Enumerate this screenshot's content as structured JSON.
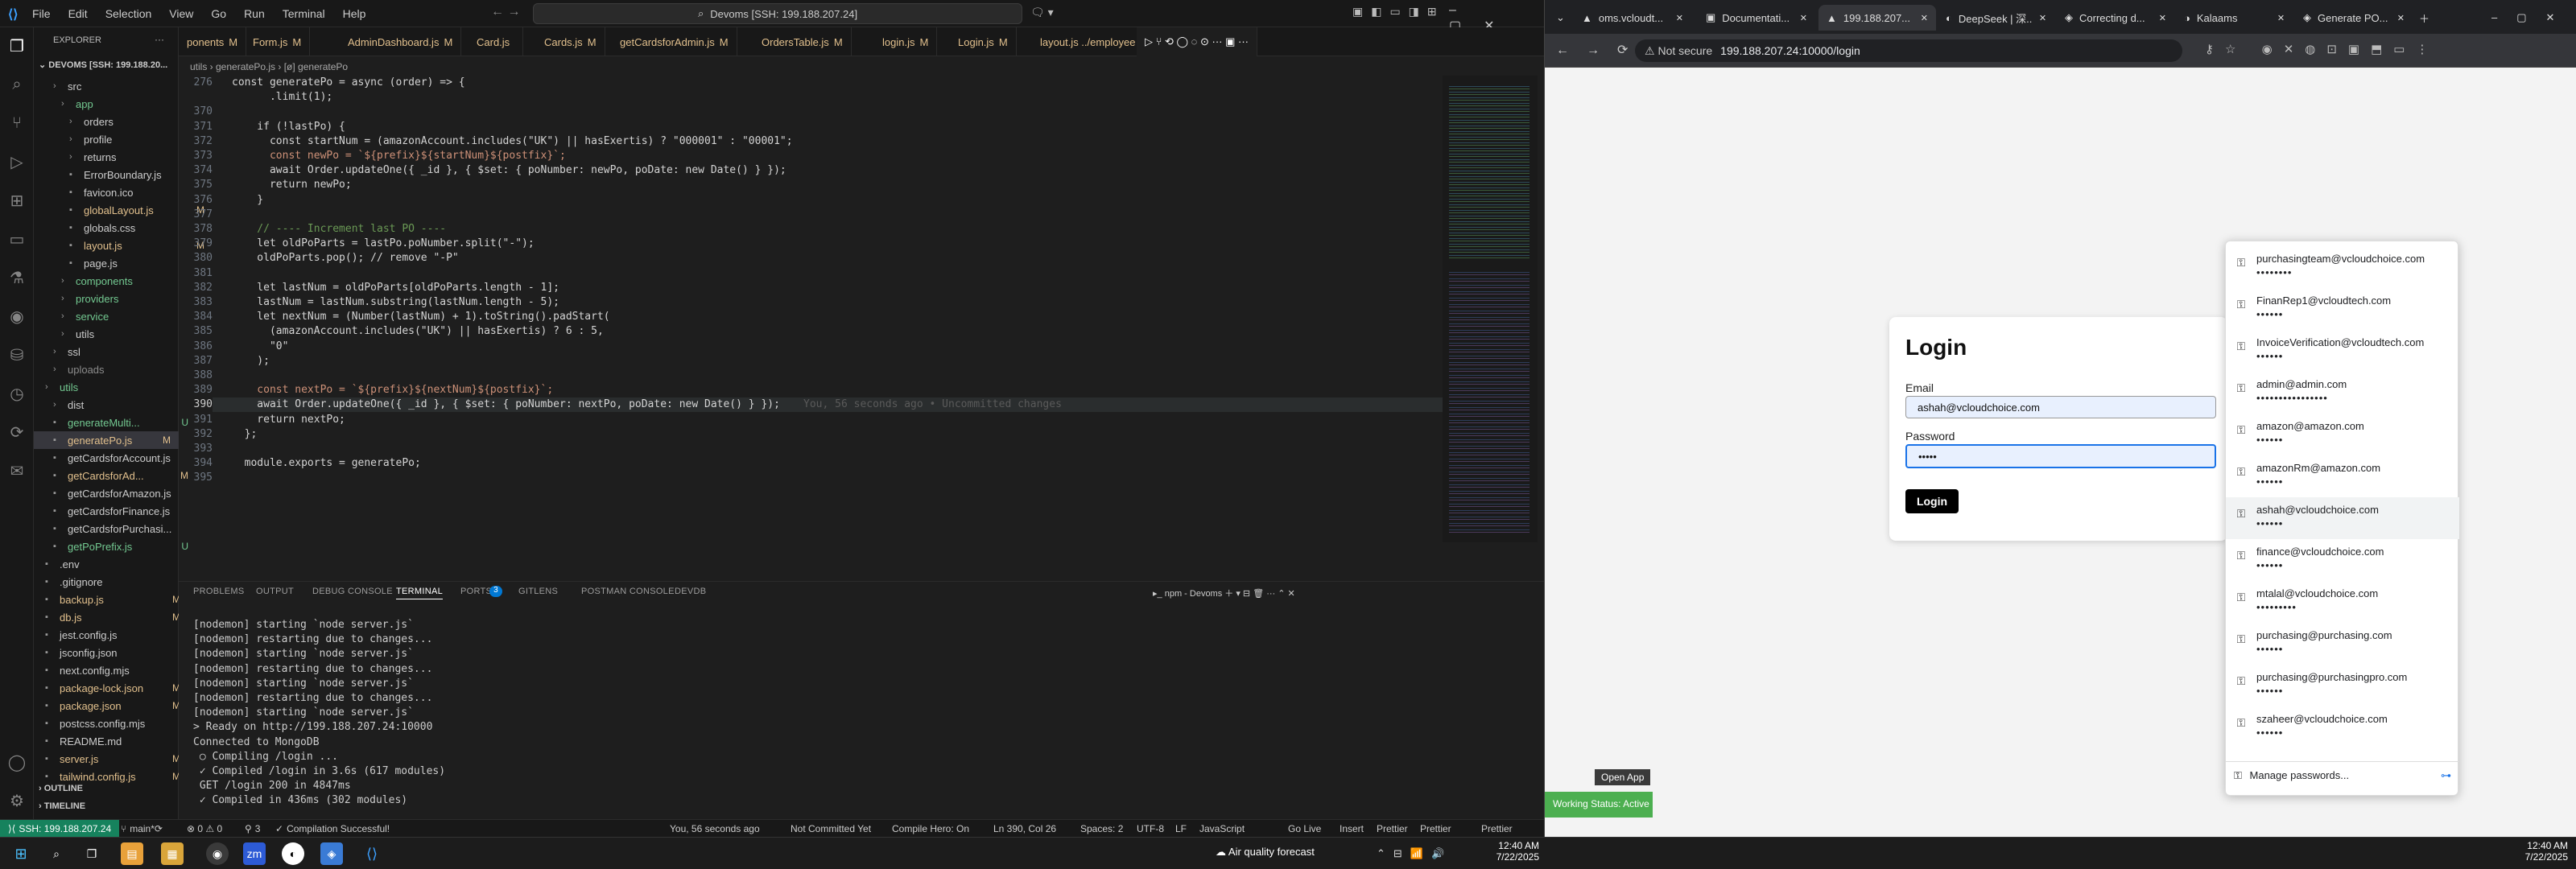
{
  "vscode": {
    "menu": [
      "File",
      "Edit",
      "Selection",
      "View",
      "Go",
      "Run",
      "Terminal",
      "Help"
    ],
    "command_center": "Devoms [SSH: 199.188.207.24]",
    "sidebar": {
      "title": "EXPLORER",
      "root": "DEVOMS [SSH: 199.188.20...",
      "items": [
        {
          "label": "src",
          "badge": "",
          "color": "#cccccc"
        },
        {
          "label": "app",
          "badge": "",
          "color": "#73c991"
        },
        {
          "label": "orders",
          "badge": "",
          "color": "#cccccc"
        },
        {
          "label": "profile",
          "badge": "",
          "color": "#cccccc"
        },
        {
          "label": "returns",
          "badge": "",
          "color": "#cccccc"
        },
        {
          "label": "ErrorBoundary.js",
          "badge": "",
          "color": "#cccccc"
        },
        {
          "label": "favicon.ico",
          "badge": "",
          "color": "#cccccc"
        },
        {
          "label": "globalLayout.js",
          "badge": "M",
          "color": "#e2c08d"
        },
        {
          "label": "globals.css",
          "badge": "",
          "color": "#cccccc"
        },
        {
          "label": "layout.js",
          "badge": "M",
          "color": "#e2c08d"
        },
        {
          "label": "page.js",
          "badge": "",
          "color": "#cccccc"
        },
        {
          "label": "components",
          "badge": "",
          "color": "#73c991"
        },
        {
          "label": "providers",
          "badge": "",
          "color": "#73c991"
        },
        {
          "label": "service",
          "badge": "",
          "color": "#73c991"
        },
        {
          "label": "utils",
          "badge": "",
          "color": "#cccccc"
        },
        {
          "label": "ssl",
          "badge": "",
          "color": "#cccccc"
        },
        {
          "label": "uploads",
          "badge": "",
          "color": "#8c8c8c"
        },
        {
          "label": "utils",
          "badge": "",
          "color": "#73c991"
        },
        {
          "label": "dist",
          "badge": "",
          "color": "#cccccc"
        },
        {
          "label": "generateMulti...",
          "badge": "U",
          "color": "#73c991"
        },
        {
          "label": "generatePo.js",
          "badge": "M",
          "color": "#e2c08d"
        },
        {
          "label": "getCardsforAccount.js",
          "badge": "",
          "color": "#cccccc"
        },
        {
          "label": "getCardsforAd...",
          "badge": "M",
          "color": "#e2c08d"
        },
        {
          "label": "getCardsforAmazon.js",
          "badge": "",
          "color": "#cccccc"
        },
        {
          "label": "getCardsforFinance.js",
          "badge": "",
          "color": "#cccccc"
        },
        {
          "label": "getCardsforPurchasi...",
          "badge": "",
          "color": "#cccccc"
        },
        {
          "label": "getPoPrefix.js",
          "badge": "U",
          "color": "#73c991"
        },
        {
          "label": ".env",
          "badge": "",
          "color": "#cccccc"
        },
        {
          "label": ".gitignore",
          "badge": "",
          "color": "#cccccc"
        },
        {
          "label": "backup.js",
          "badge": "M",
          "color": "#e2c08d"
        },
        {
          "label": "db.js",
          "badge": "M",
          "color": "#e2c08d"
        },
        {
          "label": "jest.config.js",
          "badge": "",
          "color": "#cccccc"
        },
        {
          "label": "jsconfig.json",
          "badge": "",
          "color": "#cccccc"
        },
        {
          "label": "next.config.mjs",
          "badge": "",
          "color": "#cccccc"
        },
        {
          "label": "package-lock.json",
          "badge": "M",
          "color": "#e2c08d"
        },
        {
          "label": "package.json",
          "badge": "M",
          "color": "#e2c08d"
        },
        {
          "label": "postcss.config.mjs",
          "badge": "",
          "color": "#cccccc"
        },
        {
          "label": "README.md",
          "badge": "",
          "color": "#cccccc"
        },
        {
          "label": "server.js",
          "badge": "M",
          "color": "#e2c08d"
        },
        {
          "label": "tailwind.config.js",
          "badge": "M",
          "color": "#e2c08d"
        }
      ],
      "outline": "OUTLINE",
      "timeline": "TIMELINE"
    },
    "tabs": [
      {
        "label": "ponents",
        "badge": "M"
      },
      {
        "label": "Form.js",
        "badge": "M"
      },
      {
        "label": "AdminDashboard.js",
        "badge": "M"
      },
      {
        "label": "Card.js",
        "badge": ""
      },
      {
        "label": "Cards.js",
        "badge": "M"
      },
      {
        "label": "getCardsforAdmin.js",
        "badge": "M"
      },
      {
        "label": "OrdersTable.js",
        "badge": "M"
      },
      {
        "label": "login.js",
        "badge": "M"
      },
      {
        "label": "Login.js",
        "badge": "M"
      },
      {
        "label": "layout.js ../employee",
        "badge": "M"
      }
    ],
    "breadcrumb": "utils  ›  generatePo.js  ›  [ø] generatePo",
    "code_lines": [
      {
        "n": "276",
        "t": "const generatePo = async (order) => {"
      },
      {
        "n": "",
        "t": "      .limit(1);"
      },
      {
        "n": "370",
        "t": ""
      },
      {
        "n": "371",
        "t": "    if (!lastPo) {"
      },
      {
        "n": "372",
        "t": "      const startNum = (amazonAccount.includes(\"UK\") || hasExertis) ? \"000001\" : \"00001\";"
      },
      {
        "n": "373",
        "t": "      const newPo = `${prefix}${startNum}${postfix}`;"
      },
      {
        "n": "374",
        "t": "      await Order.updateOne({ _id }, { $set: { poNumber: newPo, poDate: new Date() } });"
      },
      {
        "n": "375",
        "t": "      return newPo;"
      },
      {
        "n": "376",
        "t": "    }"
      },
      {
        "n": "377",
        "t": ""
      },
      {
        "n": "378",
        "t": "    // ---- Increment last PO ----"
      },
      {
        "n": "379",
        "t": "    let oldPoParts = lastPo.poNumber.split(\"-\");"
      },
      {
        "n": "380",
        "t": "    oldPoParts.pop(); // remove \"-P\""
      },
      {
        "n": "381",
        "t": ""
      },
      {
        "n": "382",
        "t": "    let lastNum = oldPoParts[oldPoParts.length - 1];"
      },
      {
        "n": "383",
        "t": "    lastNum = lastNum.substring(lastNum.length - 5);"
      },
      {
        "n": "384",
        "t": "    let nextNum = (Number(lastNum) + 1).toString().padStart("
      },
      {
        "n": "385",
        "t": "      (amazonAccount.includes(\"UK\") || hasExertis) ? 6 : 5,"
      },
      {
        "n": "386",
        "t": "      \"0\""
      },
      {
        "n": "387",
        "t": "    );"
      },
      {
        "n": "388",
        "t": ""
      },
      {
        "n": "389",
        "t": "    const nextPo = `${prefix}${nextNum}${postfix}`;"
      },
      {
        "n": "390",
        "t": "    await Order.updateOne({ _id }, { $set: { poNumber: nextPo, poDate: new Date() } });"
      },
      {
        "n": "391",
        "t": "    return nextPo;"
      },
      {
        "n": "392",
        "t": "  };"
      },
      {
        "n": "393",
        "t": ""
      },
      {
        "n": "394",
        "t": "  module.exports = generatePo;"
      },
      {
        "n": "395",
        "t": ""
      }
    ],
    "blame": "You, 56 seconds ago • Uncommitted changes",
    "panel_tabs": [
      "PROBLEMS",
      "OUTPUT",
      "DEBUG CONSOLE",
      "TERMINAL",
      "PORTS",
      "GITLENS",
      "POSTMAN CONSOLE",
      "DEVDB"
    ],
    "ports_count": "3",
    "terminal_name": "npm - Devoms",
    "terminal": "[nodemon] starting `node server.js`\n[nodemon] restarting due to changes...\n[nodemon] starting `node server.js`\n[nodemon] restarting due to changes...\n[nodemon] starting `node server.js`\n[nodemon] restarting due to changes...\n[nodemon] starting `node server.js`\n> Ready on http://199.188.207.24:10000\nConnected to MongoDB\n ○ Compiling /login ...\n ✓ Compiled /login in 3.6s (617 modules)\n GET /login 200 in 4847ms\n ✓ Compiled in 436ms (302 modules)",
    "status": {
      "remote": "SSH: 199.188.207.24",
      "branch": "main*",
      "problems": "⊗ 0  ⚠ 0",
      "ports": "3",
      "compile": "Compilation Successful!",
      "blame": "You, 56 seconds ago",
      "not_committed": "Not Committed Yet",
      "compile_hero": "Compile Hero: On",
      "position": "Ln 390, Col 26",
      "spaces": "Spaces: 2",
      "encoding": "UTF-8",
      "eol": "LF",
      "language": "JavaScript",
      "golive": "Go Live",
      "insert": "Insert",
      "prettier1": "Prettier",
      "prettier2": "Prettier",
      "prettier3": "Prettier"
    }
  },
  "chrome": {
    "tabs": [
      "oms.vcloudt...",
      "Documentati...",
      "199.188.207...",
      "DeepSeek | 深...",
      "Correcting d...",
      "Kalaams",
      "Generate PO..."
    ],
    "address_badge": "Not secure",
    "url": "199.188.207.24:10000/login",
    "login": {
      "title": "Login",
      "email_label": "Email",
      "email_value": "ashah@vcloudchoice.com",
      "password_label": "Password",
      "password_value": "•••••",
      "button": "Login"
    },
    "saved_passwords": [
      {
        "user": "purchasingteam@vcloudchoice.com",
        "dots": "••••••••"
      },
      {
        "user": "FinanRep1@vcloudtech.com",
        "dots": "••••••"
      },
      {
        "user": "InvoiceVerification@vcloudtech.com",
        "dots": "••••••"
      },
      {
        "user": "admin@admin.com",
        "dots": "••••••••••••••••"
      },
      {
        "user": "amazon@amazon.com",
        "dots": "••••••"
      },
      {
        "user": "amazonRm@amazon.com",
        "dots": "••••••"
      },
      {
        "user": "ashah@vcloudchoice.com",
        "dots": "••••••"
      },
      {
        "user": "finance@vcloudchoice.com",
        "dots": "••••••"
      },
      {
        "user": "mtalal@vcloudchoice.com",
        "dots": "•••••••••"
      },
      {
        "user": "purchasing@purchasing.com",
        "dots": "••••••"
      },
      {
        "user": "purchasing@purchasingpro.com",
        "dots": "••••••"
      },
      {
        "user": "szaheer@vcloudchoice.com",
        "dots": "••••••"
      }
    ],
    "manage_passwords": "Manage passwords...",
    "open_app": "Open App",
    "working_status": "Working Status: Active"
  },
  "taskbar": {
    "weather": "Air quality forecast",
    "time_right": "12:40 AM",
    "date_right": "7/22/2025",
    "time_left": "12:40 AM",
    "date_left": "7/22/2025"
  }
}
